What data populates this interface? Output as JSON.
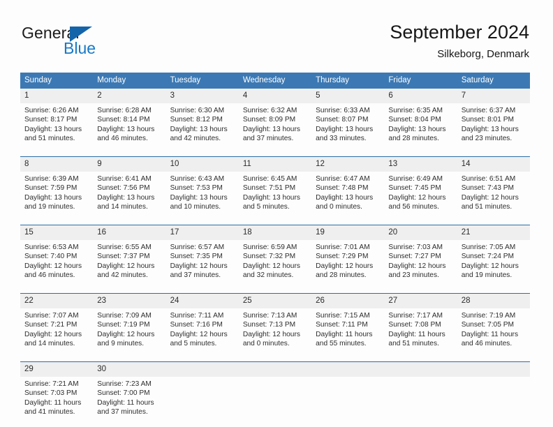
{
  "brand": {
    "name_part1": "General",
    "name_part2": "Blue",
    "triangle_color": "#1464aa",
    "blue_color": "#1679c8"
  },
  "header": {
    "title": "September 2024",
    "subtitle": "Silkeborg, Denmark"
  },
  "theme": {
    "header_blue": "#3c79b4",
    "rule_blue": "#2a6da8",
    "daynum_band": "#efefef"
  },
  "weekdays": [
    "Sunday",
    "Monday",
    "Tuesday",
    "Wednesday",
    "Thursday",
    "Friday",
    "Saturday"
  ],
  "weeks": [
    [
      {
        "day": "1",
        "sunrise": "Sunrise: 6:26 AM",
        "sunset": "Sunset: 8:17 PM",
        "daylight1": "Daylight: 13 hours",
        "daylight2": "and 51 minutes."
      },
      {
        "day": "2",
        "sunrise": "Sunrise: 6:28 AM",
        "sunset": "Sunset: 8:14 PM",
        "daylight1": "Daylight: 13 hours",
        "daylight2": "and 46 minutes."
      },
      {
        "day": "3",
        "sunrise": "Sunrise: 6:30 AM",
        "sunset": "Sunset: 8:12 PM",
        "daylight1": "Daylight: 13 hours",
        "daylight2": "and 42 minutes."
      },
      {
        "day": "4",
        "sunrise": "Sunrise: 6:32 AM",
        "sunset": "Sunset: 8:09 PM",
        "daylight1": "Daylight: 13 hours",
        "daylight2": "and 37 minutes."
      },
      {
        "day": "5",
        "sunrise": "Sunrise: 6:33 AM",
        "sunset": "Sunset: 8:07 PM",
        "daylight1": "Daylight: 13 hours",
        "daylight2": "and 33 minutes."
      },
      {
        "day": "6",
        "sunrise": "Sunrise: 6:35 AM",
        "sunset": "Sunset: 8:04 PM",
        "daylight1": "Daylight: 13 hours",
        "daylight2": "and 28 minutes."
      },
      {
        "day": "7",
        "sunrise": "Sunrise: 6:37 AM",
        "sunset": "Sunset: 8:01 PM",
        "daylight1": "Daylight: 13 hours",
        "daylight2": "and 23 minutes."
      }
    ],
    [
      {
        "day": "8",
        "sunrise": "Sunrise: 6:39 AM",
        "sunset": "Sunset: 7:59 PM",
        "daylight1": "Daylight: 13 hours",
        "daylight2": "and 19 minutes."
      },
      {
        "day": "9",
        "sunrise": "Sunrise: 6:41 AM",
        "sunset": "Sunset: 7:56 PM",
        "daylight1": "Daylight: 13 hours",
        "daylight2": "and 14 minutes."
      },
      {
        "day": "10",
        "sunrise": "Sunrise: 6:43 AM",
        "sunset": "Sunset: 7:53 PM",
        "daylight1": "Daylight: 13 hours",
        "daylight2": "and 10 minutes."
      },
      {
        "day": "11",
        "sunrise": "Sunrise: 6:45 AM",
        "sunset": "Sunset: 7:51 PM",
        "daylight1": "Daylight: 13 hours",
        "daylight2": "and 5 minutes."
      },
      {
        "day": "12",
        "sunrise": "Sunrise: 6:47 AM",
        "sunset": "Sunset: 7:48 PM",
        "daylight1": "Daylight: 13 hours",
        "daylight2": "and 0 minutes."
      },
      {
        "day": "13",
        "sunrise": "Sunrise: 6:49 AM",
        "sunset": "Sunset: 7:45 PM",
        "daylight1": "Daylight: 12 hours",
        "daylight2": "and 56 minutes."
      },
      {
        "day": "14",
        "sunrise": "Sunrise: 6:51 AM",
        "sunset": "Sunset: 7:43 PM",
        "daylight1": "Daylight: 12 hours",
        "daylight2": "and 51 minutes."
      }
    ],
    [
      {
        "day": "15",
        "sunrise": "Sunrise: 6:53 AM",
        "sunset": "Sunset: 7:40 PM",
        "daylight1": "Daylight: 12 hours",
        "daylight2": "and 46 minutes."
      },
      {
        "day": "16",
        "sunrise": "Sunrise: 6:55 AM",
        "sunset": "Sunset: 7:37 PM",
        "daylight1": "Daylight: 12 hours",
        "daylight2": "and 42 minutes."
      },
      {
        "day": "17",
        "sunrise": "Sunrise: 6:57 AM",
        "sunset": "Sunset: 7:35 PM",
        "daylight1": "Daylight: 12 hours",
        "daylight2": "and 37 minutes."
      },
      {
        "day": "18",
        "sunrise": "Sunrise: 6:59 AM",
        "sunset": "Sunset: 7:32 PM",
        "daylight1": "Daylight: 12 hours",
        "daylight2": "and 32 minutes."
      },
      {
        "day": "19",
        "sunrise": "Sunrise: 7:01 AM",
        "sunset": "Sunset: 7:29 PM",
        "daylight1": "Daylight: 12 hours",
        "daylight2": "and 28 minutes."
      },
      {
        "day": "20",
        "sunrise": "Sunrise: 7:03 AM",
        "sunset": "Sunset: 7:27 PM",
        "daylight1": "Daylight: 12 hours",
        "daylight2": "and 23 minutes."
      },
      {
        "day": "21",
        "sunrise": "Sunrise: 7:05 AM",
        "sunset": "Sunset: 7:24 PM",
        "daylight1": "Daylight: 12 hours",
        "daylight2": "and 19 minutes."
      }
    ],
    [
      {
        "day": "22",
        "sunrise": "Sunrise: 7:07 AM",
        "sunset": "Sunset: 7:21 PM",
        "daylight1": "Daylight: 12 hours",
        "daylight2": "and 14 minutes."
      },
      {
        "day": "23",
        "sunrise": "Sunrise: 7:09 AM",
        "sunset": "Sunset: 7:19 PM",
        "daylight1": "Daylight: 12 hours",
        "daylight2": "and 9 minutes."
      },
      {
        "day": "24",
        "sunrise": "Sunrise: 7:11 AM",
        "sunset": "Sunset: 7:16 PM",
        "daylight1": "Daylight: 12 hours",
        "daylight2": "and 5 minutes."
      },
      {
        "day": "25",
        "sunrise": "Sunrise: 7:13 AM",
        "sunset": "Sunset: 7:13 PM",
        "daylight1": "Daylight: 12 hours",
        "daylight2": "and 0 minutes."
      },
      {
        "day": "26",
        "sunrise": "Sunrise: 7:15 AM",
        "sunset": "Sunset: 7:11 PM",
        "daylight1": "Daylight: 11 hours",
        "daylight2": "and 55 minutes."
      },
      {
        "day": "27",
        "sunrise": "Sunrise: 7:17 AM",
        "sunset": "Sunset: 7:08 PM",
        "daylight1": "Daylight: 11 hours",
        "daylight2": "and 51 minutes."
      },
      {
        "day": "28",
        "sunrise": "Sunrise: 7:19 AM",
        "sunset": "Sunset: 7:05 PM",
        "daylight1": "Daylight: 11 hours",
        "daylight2": "and 46 minutes."
      }
    ],
    [
      {
        "day": "29",
        "sunrise": "Sunrise: 7:21 AM",
        "sunset": "Sunset: 7:03 PM",
        "daylight1": "Daylight: 11 hours",
        "daylight2": "and 41 minutes."
      },
      {
        "day": "30",
        "sunrise": "Sunrise: 7:23 AM",
        "sunset": "Sunset: 7:00 PM",
        "daylight1": "Daylight: 11 hours",
        "daylight2": "and 37 minutes."
      },
      {
        "day": "",
        "sunrise": "",
        "sunset": "",
        "daylight1": "",
        "daylight2": ""
      },
      {
        "day": "",
        "sunrise": "",
        "sunset": "",
        "daylight1": "",
        "daylight2": ""
      },
      {
        "day": "",
        "sunrise": "",
        "sunset": "",
        "daylight1": "",
        "daylight2": ""
      },
      {
        "day": "",
        "sunrise": "",
        "sunset": "",
        "daylight1": "",
        "daylight2": ""
      },
      {
        "day": "",
        "sunrise": "",
        "sunset": "",
        "daylight1": "",
        "daylight2": ""
      }
    ]
  ]
}
